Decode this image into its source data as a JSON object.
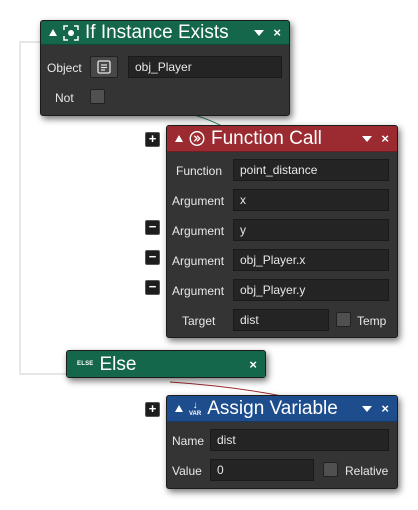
{
  "colors": {
    "green_header": "#14674a",
    "red_header": "#9c2b31",
    "blue_header": "#1e4d8e",
    "panel": "#343434",
    "field": "#242424"
  },
  "if_block": {
    "title": "If Instance Exists",
    "icon": "instance-exists-icon",
    "object_label": "Object",
    "object_value": "obj_Player",
    "not_label": "Not"
  },
  "function_block": {
    "title": "Function Call",
    "icon": "function-call-icon",
    "function_label": "Function",
    "function_value": "point_distance",
    "arguments": [
      {
        "label": "Argument",
        "value": "x"
      },
      {
        "label": "Argument",
        "value": "y"
      },
      {
        "label": "Argument",
        "value": "obj_Player.x"
      },
      {
        "label": "Argument",
        "value": "obj_Player.y"
      }
    ],
    "target_label": "Target",
    "target_value": "dist",
    "temp_label": "Temp"
  },
  "else_block": {
    "title": "Else",
    "icon_text": "ELSE"
  },
  "assign_block": {
    "title": "Assign Variable",
    "icon_text": "VAR",
    "name_label": "Name",
    "name_value": "dist",
    "value_label": "Value",
    "value_value": "0",
    "relative_label": "Relative"
  },
  "controls": {
    "plus": "+",
    "minus": "−",
    "close": "×"
  }
}
